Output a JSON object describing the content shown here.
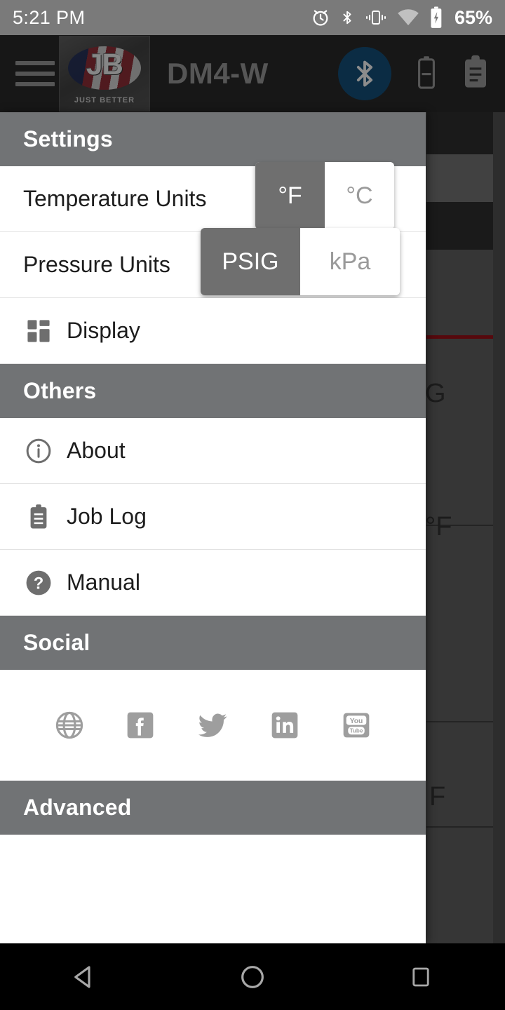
{
  "status_bar": {
    "time": "5:21 PM",
    "battery_percent": "65%",
    "icons": [
      "alarm-icon",
      "bluetooth-icon",
      "vibrate-icon",
      "wifi-icon",
      "battery-charging-icon"
    ]
  },
  "app_bar": {
    "menu_icon": "hamburger-menu-icon",
    "logo": {
      "initials": "JB",
      "tagline": "JUST BETTER"
    },
    "title": "DM4-W",
    "bluetooth_icon": "bluetooth-icon",
    "bluetooth_badge_color": "#13486f",
    "battery_icon": "battery-icon",
    "joblog_icon": "clipboard-icon"
  },
  "drawer": {
    "sections": [
      {
        "title": "Settings"
      },
      {
        "title": "Others"
      },
      {
        "title": "Social"
      },
      {
        "title": "Advanced"
      }
    ],
    "temperature": {
      "label": "Temperature Units",
      "options": [
        {
          "label": "°F",
          "selected": true
        },
        {
          "label": "°C",
          "selected": false
        }
      ]
    },
    "pressure": {
      "label": "Pressure Units",
      "options": [
        {
          "label": "PSIG",
          "selected": true
        },
        {
          "label": "kPa",
          "selected": false
        }
      ]
    },
    "display": {
      "label": "Display",
      "icon": "dashboard-grid-icon"
    },
    "others": [
      {
        "label": "About",
        "icon": "info-circle-icon"
      },
      {
        "label": "Job Log",
        "icon": "clipboard-icon"
      },
      {
        "label": "Manual",
        "icon": "question-circle-icon"
      }
    ],
    "social": [
      {
        "name": "web-globe-icon"
      },
      {
        "name": "facebook-icon"
      },
      {
        "name": "twitter-icon"
      },
      {
        "name": "linkedin-icon"
      },
      {
        "name": "youtube-icon"
      }
    ]
  },
  "background": {
    "partial_texts": [
      "G",
      "°F",
      "F"
    ],
    "accent_line_color": "#8c0f16"
  },
  "nav_bar": {
    "back": "back-triangle-icon",
    "home": "home-circle-icon",
    "recents": "recents-square-icon"
  },
  "colors": {
    "section_header": "#717375",
    "toggle_selected": "#6f6f6f",
    "app_bar": "#262626",
    "status_bar": "#7a7a7a"
  }
}
